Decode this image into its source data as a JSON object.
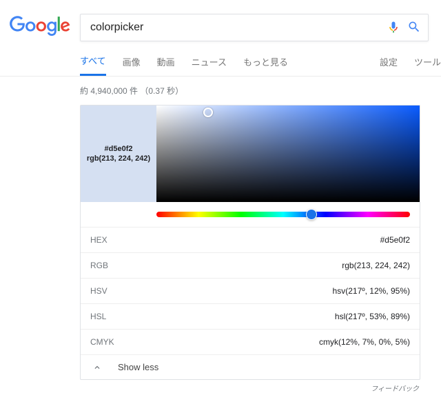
{
  "search": {
    "query": "colorpicker"
  },
  "tabs": {
    "all": "すべて",
    "images": "画像",
    "videos": "動画",
    "news": "ニュース",
    "more": "もっと見る",
    "settings": "設定",
    "tools": "ツール"
  },
  "stats": "約 4,940,000 件 （0.37 秒）",
  "swatch": {
    "hex": "#d5e0f2",
    "rgb": "rgb(213, 224, 242)"
  },
  "values": {
    "hex_label": "HEX",
    "hex_value": "#d5e0f2",
    "rgb_label": "RGB",
    "rgb_value": "rgb(213, 224, 242)",
    "hsv_label": "HSV",
    "hsv_value": "hsv(217º, 12%, 95%)",
    "hsl_label": "HSL",
    "hsl_value": "hsl(217º, 53%, 89%)",
    "cmyk_label": "CMYK",
    "cmyk_value": "cmyk(12%, 7%, 0%, 5%)"
  },
  "toggle": "Show less",
  "feedback": "フィードバック"
}
